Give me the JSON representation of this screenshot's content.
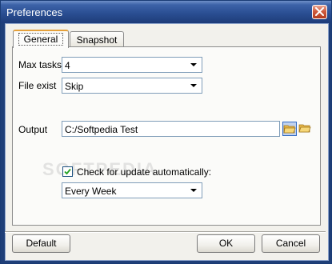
{
  "window": {
    "title": "Preferences"
  },
  "tabs": [
    {
      "label": "General",
      "active": true
    },
    {
      "label": "Snapshot",
      "active": false
    }
  ],
  "fields": {
    "max_tasks": {
      "label": "Max tasks",
      "value": "4"
    },
    "file_exist": {
      "label": "File exist",
      "value": "Skip"
    },
    "output": {
      "label": "Output",
      "value": "C:/Softpedia Test"
    },
    "update_check": {
      "label": "Check for update automatically:",
      "checked": true
    },
    "update_frequency": {
      "value": "Every Week"
    }
  },
  "buttons": {
    "default": "Default",
    "ok": "OK",
    "cancel": "Cancel"
  },
  "watermark": "SOFTPEDIA",
  "icons": {
    "close": "close-icon",
    "folder_open": "folder-open-icon",
    "folder": "folder-icon",
    "dropdown": "chevron-down-icon",
    "check": "checkmark-icon"
  }
}
